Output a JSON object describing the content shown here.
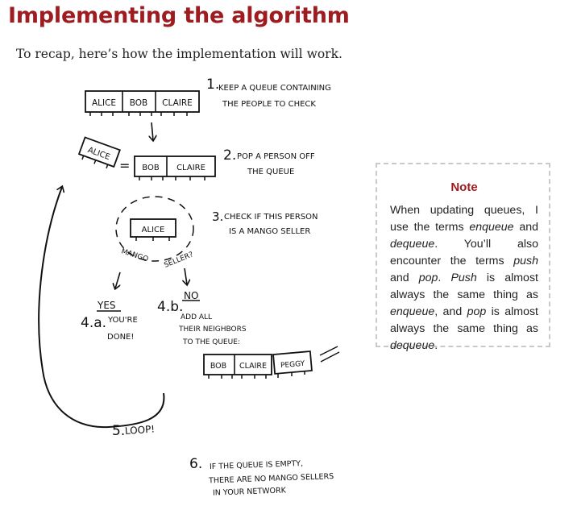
{
  "heading": "Implementing the algorithm",
  "intro": "To recap, here’s how the implementation will work.",
  "diagram": {
    "step1": {
      "number": "1.",
      "line1": "KEEP A QUEUE CONTAINING",
      "line2": "THE PEOPLE TO CHECK"
    },
    "queue1": [
      "ALICE",
      "BOB",
      "CLAIRE"
    ],
    "step2": {
      "number": "2.",
      "line1": "POP A PERSON OFF",
      "line2": "THE QUEUE"
    },
    "popped": "ALICE",
    "equals": "=",
    "queue2": [
      "BOB",
      "CLAIRE"
    ],
    "step3": {
      "number": "3.",
      "line1": "CHECK IF THIS PERSON",
      "line2": "IS A MANGO SELLER"
    },
    "check_person": "ALICE",
    "mango_label": "MANGO",
    "seller_label": "SELLER?",
    "yes_label": "YES",
    "step4a": {
      "number": "4.a.",
      "line1": "YOU'RE",
      "line2": "DONE!"
    },
    "no_label": "NO",
    "step4b": {
      "number": "4.b.",
      "line1": "ADD ALL",
      "line2": "THEIR NEIGHBORS",
      "line3": "TO THE QUEUE:"
    },
    "queue3": [
      "BOB",
      "CLAIRE",
      "PEGGY"
    ],
    "step5": {
      "number": "5.",
      "text": "LOOP!"
    },
    "step6": {
      "number": "6.",
      "line1": "IF THE QUEUE IS EMPTY,",
      "line2": "THERE ARE NO MANGO SELLERS",
      "line3": "IN YOUR NETWORK"
    }
  },
  "note": {
    "title": "Note",
    "p1": "When updating queues, I use the terms ",
    "t1": "enqueue",
    "p2": " and ",
    "t2": "dequeue",
    "p3": ". You’ll also encounter the terms ",
    "t3": "push",
    "p4": " and ",
    "t4": "pop",
    "p5": ". ",
    "t5": "Push",
    "p6": " is almost always the same thing as ",
    "t6": "enqueue",
    "p7": ", and ",
    "t7": "pop",
    "p8": " is almost always the same thing as ",
    "t8": "dequeue",
    "p9": "."
  }
}
